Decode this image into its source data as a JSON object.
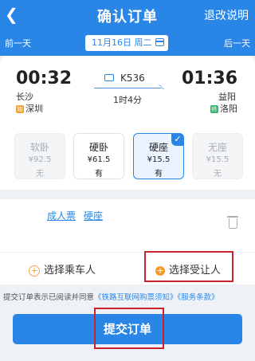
{
  "header": {
    "back_icon": "chevron-left-icon",
    "title": "确认订单",
    "refund_label": "退改说明"
  },
  "datebar": {
    "prev_label": "前一天",
    "next_label": "后一天",
    "date_text": "11月16日 周二",
    "calendar_icon": "calendar-icon"
  },
  "trip": {
    "depart_time": "00:32",
    "depart_city": "长沙",
    "depart_station": "深圳",
    "depart_badge": "始",
    "train_no": "K536",
    "duration": "1时4分",
    "arrive_time": "01:36",
    "arrive_city": "益阳",
    "arrive_station": "洛阳",
    "arrive_badge": "终"
  },
  "seats": [
    {
      "name": "软卧",
      "price": "¥92.5",
      "status": "无",
      "state": "disabled"
    },
    {
      "name": "硬卧",
      "price": "¥61.5",
      "status": "有",
      "state": "available"
    },
    {
      "name": "硬座",
      "price": "¥15.5",
      "status": "有",
      "state": "selected"
    },
    {
      "name": "无座",
      "price": "¥15.5",
      "status": "无",
      "state": "disabled"
    }
  ],
  "passenger": {
    "ticket_type": "成人票",
    "seat_type": "硬座"
  },
  "actions": {
    "add_passenger": "选择乘车人",
    "add_recipient": "选择受让人"
  },
  "agreement": {
    "prefix": "提交订单表示已阅读并同意",
    "link1": "《铁路互联网购票须知》",
    "link2": "《服务条款》"
  },
  "submit_label": "提交订单",
  "colors": {
    "primary": "#2a86e6",
    "highlight_box": "#c8232c",
    "orange": "#f39a2b"
  }
}
